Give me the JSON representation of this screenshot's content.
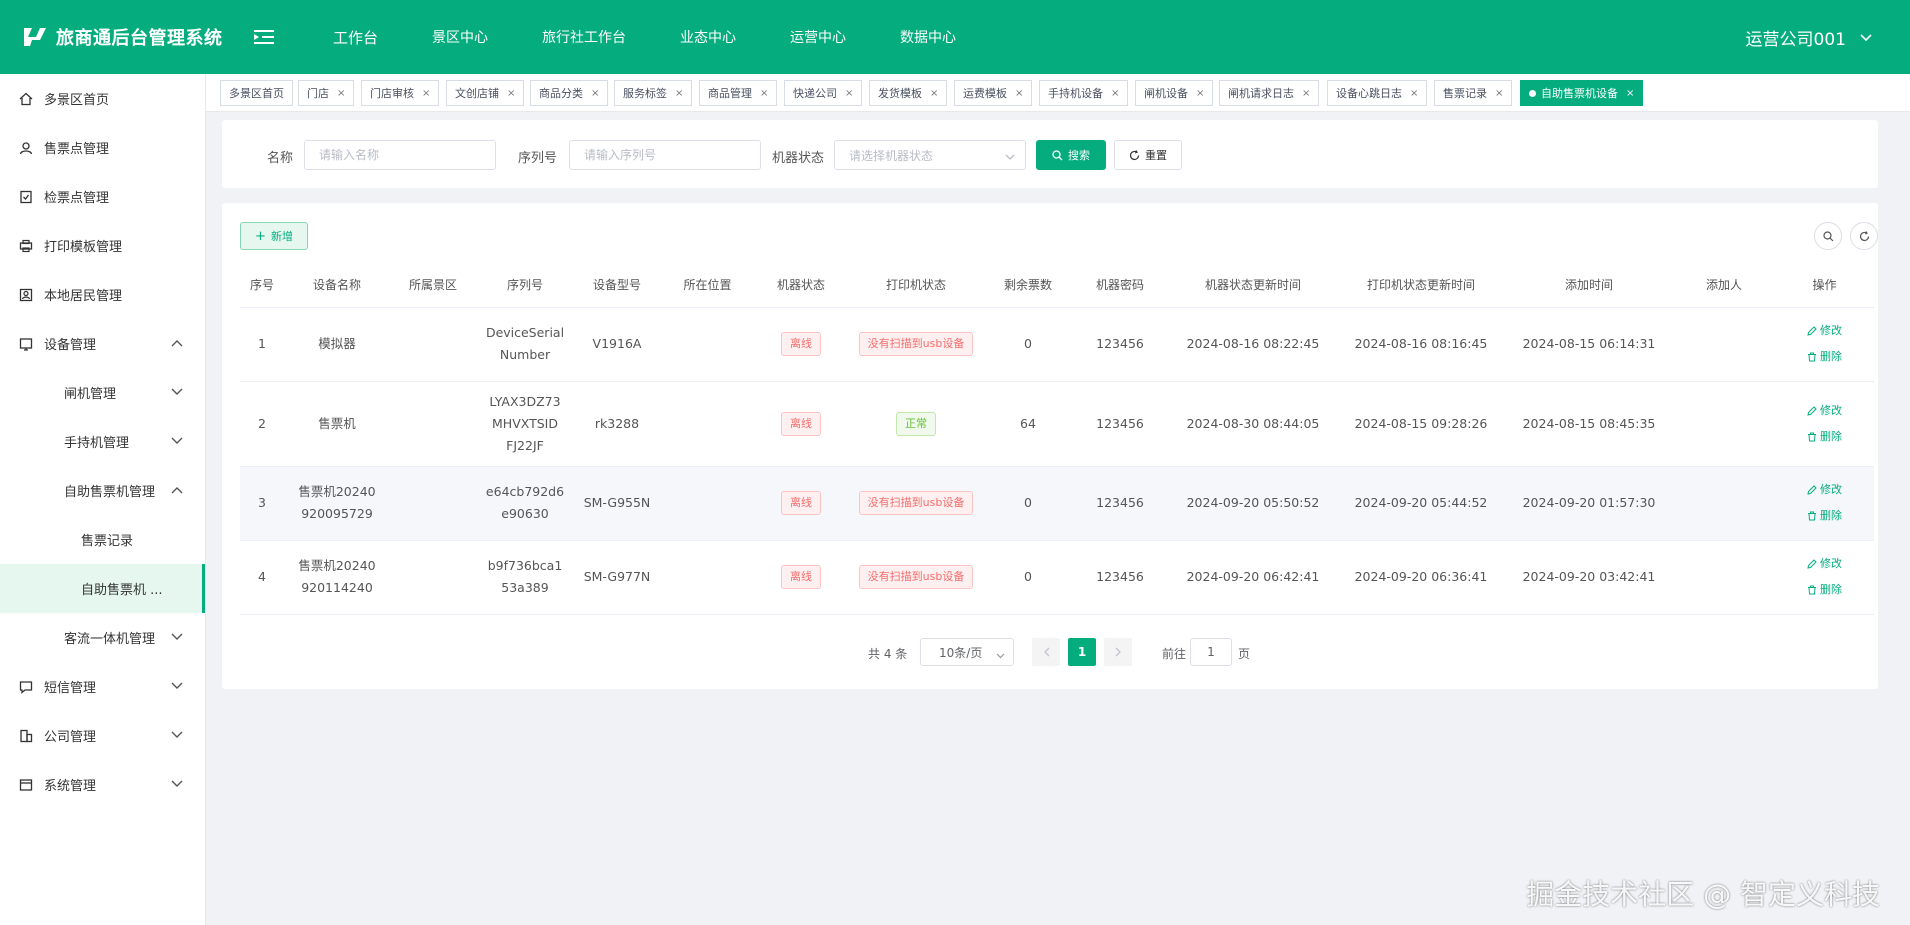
{
  "app": {
    "title": "旅商通后台管理系统",
    "user": "运营公司001"
  },
  "topnav": [
    "工作台",
    "景区中心",
    "旅行社工作台",
    "业态中心",
    "运营中心",
    "数据中心"
  ],
  "sidebar": {
    "items": [
      {
        "label": "多景区首页",
        "icon": "home-icon"
      },
      {
        "label": "售票点管理",
        "icon": "ticket-point-icon"
      },
      {
        "label": "检票点管理",
        "icon": "check-point-icon"
      },
      {
        "label": "打印模板管理",
        "icon": "print-template-icon"
      },
      {
        "label": "本地居民管理",
        "icon": "resident-icon"
      },
      {
        "label": "设备管理",
        "icon": "device-icon"
      },
      {
        "label": "闸机管理"
      },
      {
        "label": "手持机管理"
      },
      {
        "label": "自助售票机管理"
      },
      {
        "label": "售票记录"
      },
      {
        "label": "自助售票机 ..."
      },
      {
        "label": "客流一体机管理"
      },
      {
        "label": "短信管理",
        "icon": "sms-icon"
      },
      {
        "label": "公司管理",
        "icon": "company-icon"
      },
      {
        "label": "系统管理",
        "icon": "system-icon"
      }
    ]
  },
  "tabs": [
    "多景区首页",
    "门店",
    "门店审核",
    "文创店铺",
    "商品分类",
    "服务标签",
    "商品管理",
    "快递公司",
    "发货模板",
    "运费模板",
    "手持机设备",
    "闸机设备",
    "闸机请求日志",
    "设备心跳日志",
    "售票记录",
    "自助售票机设备"
  ],
  "search": {
    "name_label": "名称",
    "name_placeholder": "请输入名称",
    "serial_label": "序列号",
    "serial_placeholder": "请输入序列号",
    "status_label": "机器状态",
    "status_placeholder": "请选择机器状态",
    "search_btn": "搜索",
    "reset_btn": "重置"
  },
  "toolbar": {
    "add_label": "新增"
  },
  "table": {
    "headers": [
      "序号",
      "设备名称",
      "所属景区",
      "序列号",
      "设备型号",
      "所在位置",
      "机器状态",
      "打印机状态",
      "剩余票数",
      "机器密码",
      "机器状态更新时间",
      "打印机状态更新时间",
      "添加时间",
      "添加人",
      "操作"
    ],
    "rows": [
      {
        "no": "1",
        "name": "模拟器",
        "scenic": "",
        "serial": "DeviceSerial Number",
        "model": "V1916A",
        "location": "",
        "status": "离线",
        "printer": "没有扫描到usb设备",
        "printer_ok": false,
        "remain": "0",
        "pwd": "123456",
        "status_time": "2024-08-16 08:22:45",
        "printer_time": "2024-08-16 08:16:45",
        "add_time": "2024-08-15 06:14:31",
        "adder": ""
      },
      {
        "no": "2",
        "name": "售票机",
        "scenic": "",
        "serial": "LYAX3DZ73 MHVXTSID FJ22JF",
        "model": "rk3288",
        "location": "",
        "status": "离线",
        "printer": "正常",
        "printer_ok": true,
        "remain": "64",
        "pwd": "123456",
        "status_time": "2024-08-30 08:44:05",
        "printer_time": "2024-08-15 09:28:26",
        "add_time": "2024-08-15 08:45:35",
        "adder": ""
      },
      {
        "no": "3",
        "name": "售票机20240 920095729",
        "scenic": "",
        "serial": "e64cb792d6 e90630",
        "model": "SM-G955N",
        "location": "",
        "status": "离线",
        "printer": "没有扫描到usb设备",
        "printer_ok": false,
        "remain": "0",
        "pwd": "123456",
        "status_time": "2024-09-20 05:50:52",
        "printer_time": "2024-09-20 05:44:52",
        "add_time": "2024-09-20 01:57:30",
        "adder": ""
      },
      {
        "no": "4",
        "name": "售票机20240 920114240",
        "scenic": "",
        "serial": "b9f736bca1 53a389",
        "model": "SM-G977N",
        "location": "",
        "status": "离线",
        "printer": "没有扫描到usb设备",
        "printer_ok": false,
        "remain": "0",
        "pwd": "123456",
        "status_time": "2024-09-20 06:42:41",
        "printer_time": "2024-09-20 06:36:41",
        "add_time": "2024-09-20 03:42:41",
        "adder": ""
      }
    ],
    "edit_label": "修改",
    "delete_label": "删除"
  },
  "pagination": {
    "total": "共 4 条",
    "page_size": "10条/页",
    "current": "1",
    "goto_label": "前往",
    "goto_value": "1",
    "page_label": "页"
  },
  "watermark": "掘金技术社区 @ 智定义科技",
  "colors": {
    "primary": "#05ad7e",
    "danger": "#f56c6c",
    "success": "#67c23a"
  }
}
